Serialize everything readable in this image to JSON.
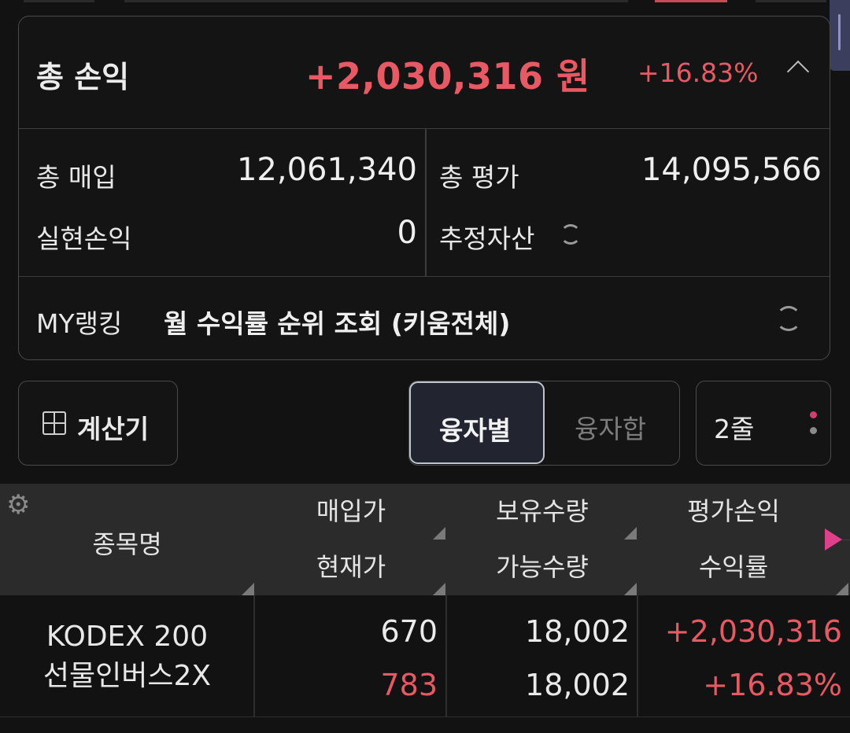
{
  "summary": {
    "total_label": "총 손익",
    "total_amount": "+2,030,316 원",
    "total_pct": "+16.83%",
    "total_purchase_label": "총 매입",
    "total_purchase_value": "12,061,340",
    "total_eval_label": "총 평가",
    "total_eval_value": "14,095,566",
    "realized_label": "실현손익",
    "realized_value": "0",
    "estimated_label": "추정자산",
    "ranking_label": "MY랭킹",
    "ranking_text": "월 수익률 순위 조회 (키움전체)"
  },
  "controls": {
    "calculator_label": "계산기",
    "seg_by_loan": "융자별",
    "seg_loan_sum": "융자합",
    "lines_label": "2줄"
  },
  "table": {
    "headers": {
      "name": "종목명",
      "buy_price": "매입가",
      "holding_qty": "보유수량",
      "eval_pl": "평가손익",
      "current_price": "현재가",
      "available_qty": "가능수량",
      "return_rate": "수익률"
    },
    "rows": [
      {
        "name_line1": "KODEX 200",
        "name_line2": "선물인버스2X",
        "buy_price": "670",
        "current_price": "783",
        "holding_qty": "18,002",
        "available_qty": "18,002",
        "eval_pl": "+2,030,316",
        "return_rate": "+16.83%"
      }
    ]
  },
  "colors": {
    "profit": "#e85a63",
    "accent_pink": "#e0408a",
    "background": "#121212"
  },
  "icons": [
    "chevron-up-icon",
    "refresh-icon",
    "calculator-icon",
    "more-dots-icon",
    "gear-icon",
    "arrow-right-icon"
  ]
}
